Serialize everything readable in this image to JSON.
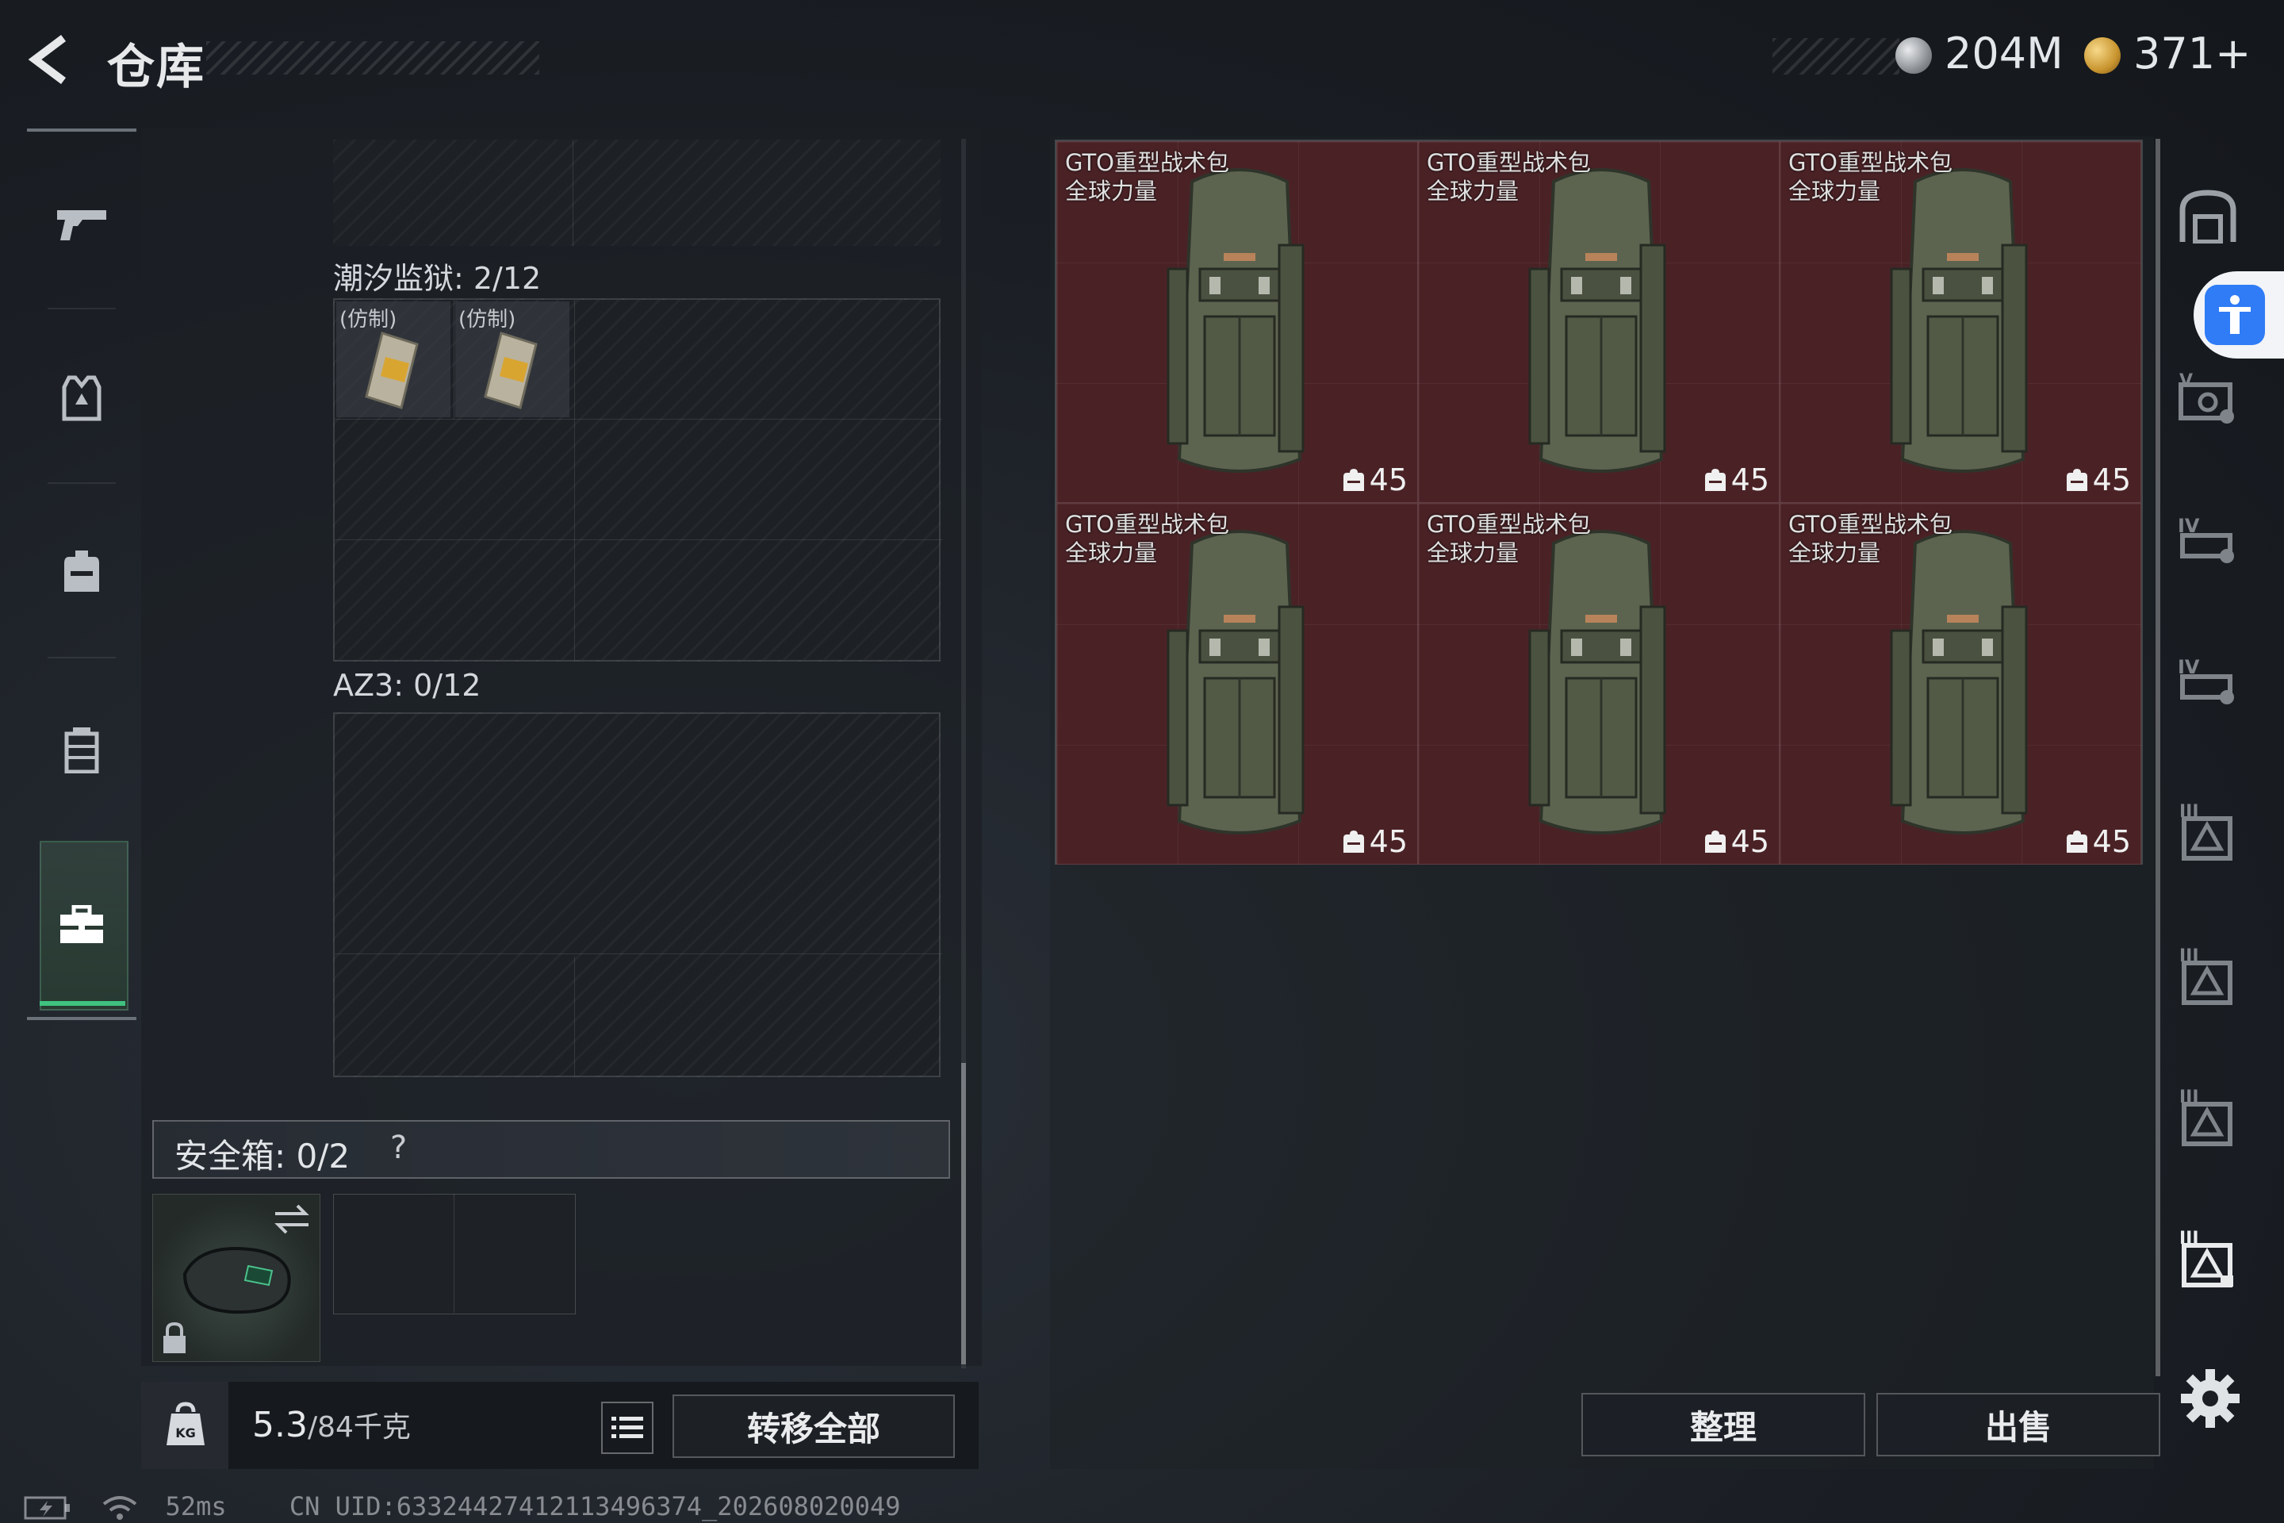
{
  "header": {
    "title": "仓库",
    "currency_silver": "204M",
    "currency_gold": "371+"
  },
  "left_nav": {
    "items": [
      "weapon",
      "armor-vest",
      "backpack",
      "chest-rig",
      "toolbox"
    ],
    "selected": "toolbox"
  },
  "containers": {
    "tide_prison_label": "潮汐监狱: 2/12",
    "tide_prison_items": [
      "(仿制)",
      "(仿制)"
    ],
    "az3_label": "AZ3: 0/12",
    "safe_box_label": "安全箱: 0/2",
    "safe_box_help": "?"
  },
  "bottom_left": {
    "weight_current": "5.3",
    "weight_max": "/84千克",
    "transfer_all": "转移全部"
  },
  "storage": {
    "items": [
      {
        "name_line1": "GTO重型战术包",
        "name_line2": "全球力量",
        "count": "45"
      },
      {
        "name_line1": "GTO重型战术包",
        "name_line2": "全球力量",
        "count": "45"
      },
      {
        "name_line1": "GTO重型战术包",
        "name_line2": "全球力量",
        "count": "45"
      },
      {
        "name_line1": "GTO重型战术包",
        "name_line2": "全球力量",
        "count": "45"
      },
      {
        "name_line1": "GTO重型战术包",
        "name_line2": "全球力量",
        "count": "45"
      },
      {
        "name_line1": "GTO重型战术包",
        "name_line2": "全球力量",
        "count": "45"
      }
    ],
    "sort_label": "整理",
    "sell_label": "出售",
    "item_bg_color": "#4a2226"
  },
  "status_bar": {
    "ping": "52ms",
    "uid": "CN UID:6332442741211349​6374_202608020049"
  }
}
